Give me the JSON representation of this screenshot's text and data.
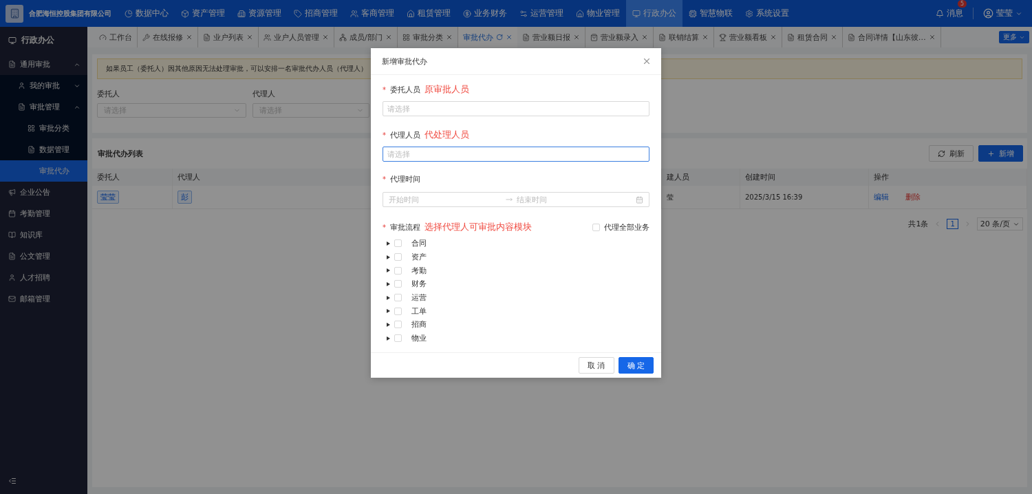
{
  "topbar": {
    "company": "合肥海恒控股集团有限公司",
    "nav": [
      {
        "label": "数据中心",
        "selected": false
      },
      {
        "label": "资产管理",
        "selected": false
      },
      {
        "label": "资源管理",
        "selected": false
      },
      {
        "label": "招商管理",
        "selected": false
      },
      {
        "label": "客商管理",
        "selected": false
      },
      {
        "label": "租赁管理",
        "selected": false
      },
      {
        "label": "业务财务",
        "selected": false
      },
      {
        "label": "运营管理",
        "selected": false
      },
      {
        "label": "物业管理",
        "selected": false
      },
      {
        "label": "行政办公",
        "selected": true
      },
      {
        "label": "智慧物联",
        "selected": false
      },
      {
        "label": "系统设置",
        "selected": false
      }
    ],
    "messages": {
      "label": "消息",
      "badge": "5"
    },
    "user": "莹莹"
  },
  "sidebar": {
    "header": "行政办公",
    "items": [
      {
        "label": "通用审批",
        "expanded": true,
        "selected": false,
        "children": [
          {
            "label": "我的审批",
            "expanded": false,
            "selected": false
          },
          {
            "label": "审批管理",
            "expanded": true,
            "selected": false,
            "children": [
              {
                "label": "审批分类",
                "selected": false
              },
              {
                "label": "数据管理",
                "selected": false
              },
              {
                "label": "审批代办",
                "selected": true
              }
            ]
          }
        ]
      },
      {
        "label": "企业公告",
        "selected": false
      },
      {
        "label": "考勤管理",
        "selected": false
      },
      {
        "label": "知识库",
        "selected": false
      },
      {
        "label": "公文管理",
        "selected": false
      },
      {
        "label": "人才招聘",
        "selected": false
      },
      {
        "label": "邮箱管理",
        "selected": false
      }
    ]
  },
  "tabs": [
    {
      "label": "工作台",
      "selected": false,
      "closable": false
    },
    {
      "label": "在线报修",
      "selected": false,
      "closable": true
    },
    {
      "label": "业户列表",
      "selected": false,
      "closable": true
    },
    {
      "label": "业户人员管理",
      "selected": false,
      "closable": true
    },
    {
      "label": "成员/部门",
      "selected": false,
      "closable": true
    },
    {
      "label": "审批分类",
      "selected": false,
      "closable": true
    },
    {
      "label": "审批代办",
      "selected": true,
      "closable": true
    },
    {
      "label": "营业额日报",
      "selected": false,
      "closable": true
    },
    {
      "label": "营业额录入",
      "selected": false,
      "closable": true
    },
    {
      "label": "联销结算",
      "selected": false,
      "closable": true
    },
    {
      "label": "营业额看板",
      "selected": false,
      "closable": true
    },
    {
      "label": "租赁合同",
      "selected": false,
      "closable": true
    },
    {
      "label": "合同详情【山东彼…",
      "selected": false,
      "closable": true
    }
  ],
  "more": "更多",
  "alert": "如果员工（委托人）因其他原因无法处理审批，可以安排一名审批代办人员（代理人）",
  "filters": [
    {
      "label": "委托人",
      "placeholder": "请选择"
    },
    {
      "label": "代理人",
      "placeholder": "请选择"
    }
  ],
  "list": {
    "title": "审批代办列表",
    "refresh": "刷新",
    "add": "新增",
    "columns": [
      "委托人",
      "代理人",
      "建人员",
      "创建时间",
      "操作"
    ],
    "rows": [
      {
        "principal": "莹莹",
        "agent": "彭",
        "creator": "莹",
        "created": "2025/3/15 16:39",
        "edit": "编辑",
        "delete": "删除"
      }
    ],
    "total": "共1条",
    "pages": [
      {
        "label": "1",
        "selected": true
      }
    ],
    "page_size": "20 条/页"
  },
  "modal": {
    "title": "新增审批代办",
    "fields": [
      {
        "kind": "select",
        "required": "*",
        "label": "委托人员",
        "hint": "原审批人员",
        "placeholder": "请选择",
        "focused": false
      },
      {
        "kind": "select",
        "required": "*",
        "label": "代理人员",
        "hint": "代处理人员",
        "placeholder": "请选择",
        "focused": true
      },
      {
        "kind": "range",
        "required": "*",
        "label": "代理时间",
        "start": "开始时间",
        "end": "结束时间"
      }
    ],
    "flow": {
      "required": "*",
      "label": "审批流程",
      "hint": "选择代理人可审批内容模块",
      "all": {
        "label": "代理全部业务",
        "checked": false
      },
      "items": [
        {
          "label": "合同",
          "checked": false,
          "expanded": false
        },
        {
          "label": "资产",
          "checked": false,
          "expanded": false
        },
        {
          "label": "考勤",
          "checked": false,
          "expanded": false
        },
        {
          "label": "财务",
          "checked": false,
          "expanded": false
        },
        {
          "label": "运营",
          "checked": false,
          "expanded": false
        },
        {
          "label": "工单",
          "checked": false,
          "expanded": false
        },
        {
          "label": "招商",
          "checked": false,
          "expanded": false
        },
        {
          "label": "物业",
          "checked": false,
          "expanded": false
        }
      ]
    },
    "cancel": "取 消",
    "ok": "确 定"
  }
}
